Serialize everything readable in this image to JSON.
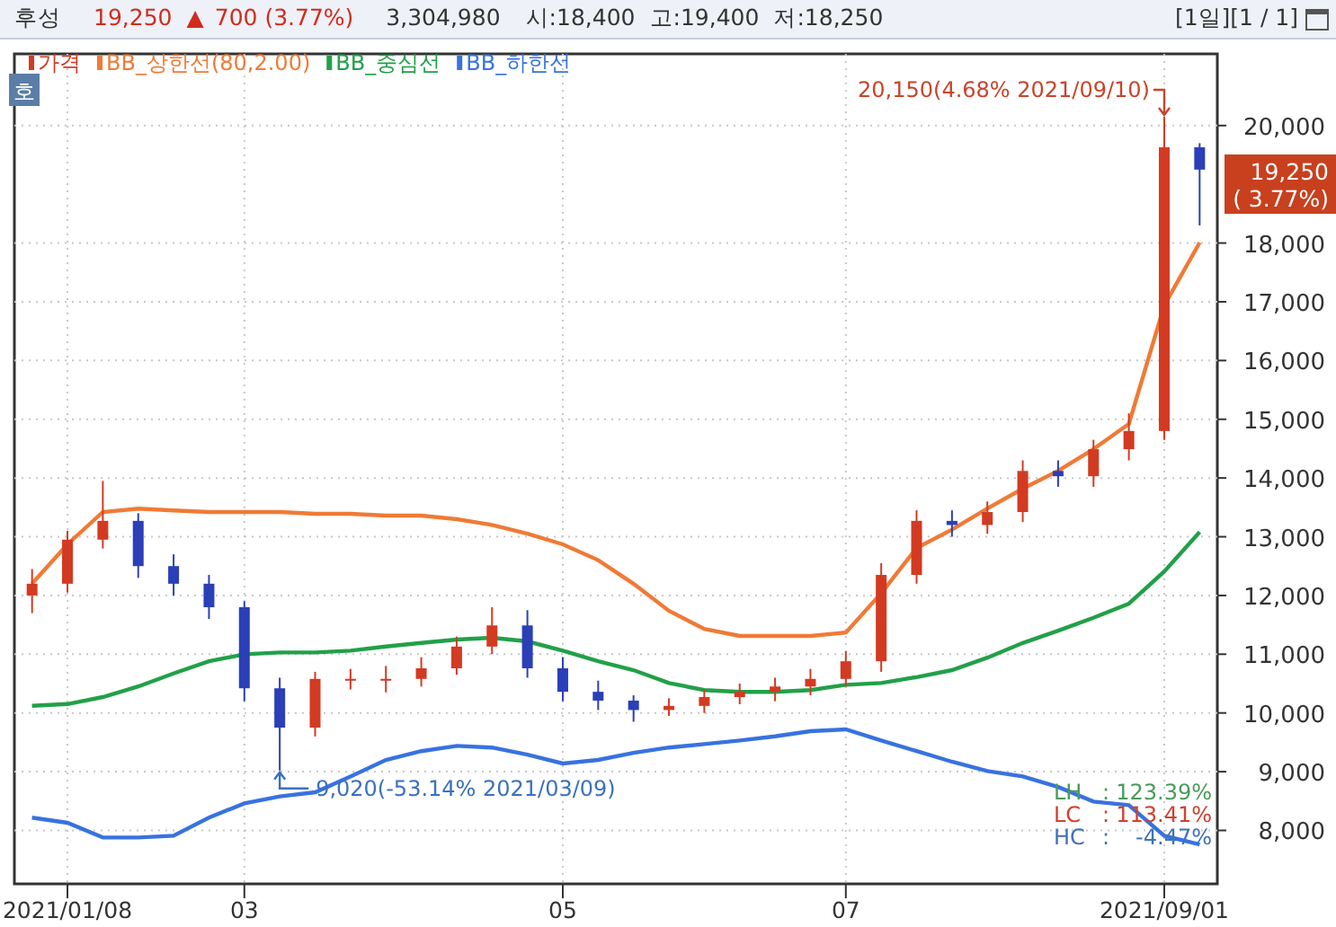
{
  "header": {
    "name": "후성",
    "price": "19,250",
    "arrow": "▲",
    "change": "700 (3.77%)",
    "volume": "3,304,980",
    "open": "시:18,400",
    "high": "고:19,400",
    "low": "저:18,250",
    "period": "[1일]",
    "page": "[1 / 1]"
  },
  "badge": "호",
  "chart": {
    "price_legend": {
      "label": "가격",
      "color": "#d33a22"
    },
    "chart_data": {
      "type": "candlestick",
      "categories": [
        null,
        "2021/01/08",
        null,
        null,
        null,
        null,
        "03",
        null,
        null,
        null,
        null,
        null,
        null,
        null,
        null,
        "05",
        null,
        null,
        null,
        null,
        null,
        null,
        null,
        "07",
        null,
        null,
        null,
        null,
        null,
        null,
        null,
        null,
        "2021/09/01",
        null
      ],
      "ohlc": [
        [
          12000,
          12450,
          11700,
          12200
        ],
        [
          12200,
          13100,
          12050,
          12950
        ],
        [
          12950,
          13950,
          12800,
          13270
        ],
        [
          13270,
          13400,
          12300,
          12500
        ],
        [
          12500,
          12700,
          12000,
          12200
        ],
        [
          12200,
          12350,
          11600,
          11800
        ],
        [
          11800,
          11900,
          10200,
          10420
        ],
        [
          10420,
          10600,
          9020,
          9750
        ],
        [
          9750,
          10700,
          9600,
          10580
        ],
        [
          10580,
          10750,
          10400,
          10580
        ],
        [
          10580,
          10800,
          10350,
          10580
        ],
        [
          10580,
          10950,
          10450,
          10760
        ],
        [
          10760,
          11300,
          10650,
          11130
        ],
        [
          11130,
          11800,
          11000,
          11490
        ],
        [
          11490,
          11750,
          10600,
          10760
        ],
        [
          10760,
          10950,
          10200,
          10360
        ],
        [
          10360,
          10550,
          10050,
          10210
        ],
        [
          10210,
          10300,
          9850,
          10050
        ],
        [
          10050,
          10250,
          9950,
          10120
        ],
        [
          10120,
          10400,
          10000,
          10270
        ],
        [
          10270,
          10500,
          10150,
          10360
        ],
        [
          10360,
          10600,
          10200,
          10450
        ],
        [
          10450,
          10750,
          10300,
          10580
        ],
        [
          10580,
          11050,
          10450,
          10880
        ],
        [
          10880,
          12550,
          10700,
          12350
        ],
        [
          12350,
          13450,
          12200,
          13270
        ],
        [
          13270,
          13450,
          13000,
          13200
        ],
        [
          13200,
          13600,
          13050,
          13420
        ],
        [
          13420,
          14300,
          13250,
          14120
        ],
        [
          14120,
          14300,
          13850,
          14030
        ],
        [
          14030,
          14650,
          13850,
          14490
        ],
        [
          14490,
          15100,
          14300,
          14800
        ],
        [
          14800,
          20150,
          14650,
          19630
        ],
        [
          19630,
          19700,
          18300,
          19250
        ]
      ],
      "series": [
        {
          "name": "BB_상한선(80,2.00)",
          "type": "line",
          "color": "#f07a36",
          "values": [
            12200,
            12870,
            13420,
            13480,
            13450,
            13420,
            13420,
            13420,
            13390,
            13390,
            13360,
            13360,
            13300,
            13200,
            13050,
            12870,
            12600,
            12200,
            11740,
            11430,
            11310,
            11310,
            11310,
            11370,
            12040,
            12810,
            13120,
            13480,
            13820,
            14120,
            14490,
            14920,
            16940,
            18010
          ]
        },
        {
          "name": "BB_중심선",
          "type": "line",
          "color": "#22a048",
          "values": [
            10120,
            10150,
            10270,
            10450,
            10670,
            10880,
            11000,
            11030,
            11030,
            11060,
            11130,
            11190,
            11250,
            11280,
            11220,
            11060,
            10880,
            10730,
            10510,
            10390,
            10360,
            10360,
            10390,
            10480,
            10510,
            10610,
            10730,
            10940,
            11190,
            11400,
            11620,
            11860,
            12410,
            13080
          ]
        },
        {
          "name": "BB_하한선",
          "type": "line",
          "color": "#3872e0",
          "values": [
            8220,
            8130,
            7880,
            7880,
            7910,
            8220,
            8460,
            8580,
            8650,
            8920,
            9200,
            9350,
            9440,
            9410,
            9290,
            9140,
            9200,
            9320,
            9410,
            9470,
            9530,
            9600,
            9690,
            9720,
            9530,
            9350,
            9170,
            9010,
            8920,
            8740,
            8490,
            8430,
            7910,
            7760
          ]
        }
      ],
      "ylim": [
        7090,
        21220
      ],
      "grid": true,
      "legend": "upper left",
      "yticks": [
        {
          "value": 8000,
          "label": "8,000"
        },
        {
          "value": 9000,
          "label": "9,000"
        },
        {
          "value": 10000,
          "label": "10,000"
        },
        {
          "value": 11000,
          "label": "11,000"
        },
        {
          "value": 12000,
          "label": "12,000"
        },
        {
          "value": 13000,
          "label": "13,000"
        },
        {
          "value": 14000,
          "label": "14,000"
        },
        {
          "value": 15000,
          "label": "15,000"
        },
        {
          "value": 16000,
          "label": "16,000"
        },
        {
          "value": 17000,
          "label": "17,000"
        },
        {
          "value": 18000,
          "label": "18,000"
        },
        {
          "value": 20000,
          "label": "20,000"
        }
      ],
      "annotations": [
        "20,150(4.68% 2021/09/10)",
        "9,020(-53.14% 2021/03/09)"
      ]
    },
    "last_price": {
      "value": "19,250",
      "change": "( 3.77%)"
    },
    "stats": [
      {
        "label": "LH",
        "colon": ":",
        "value": "123.39%",
        "color": "#4a9a5a"
      },
      {
        "label": "LC",
        "colon": ":",
        "value": "113.41%",
        "color": "#d04030"
      },
      {
        "label": "HC",
        "colon": ":",
        "value": "-4.47%",
        "color": "#4070c0"
      }
    ]
  }
}
